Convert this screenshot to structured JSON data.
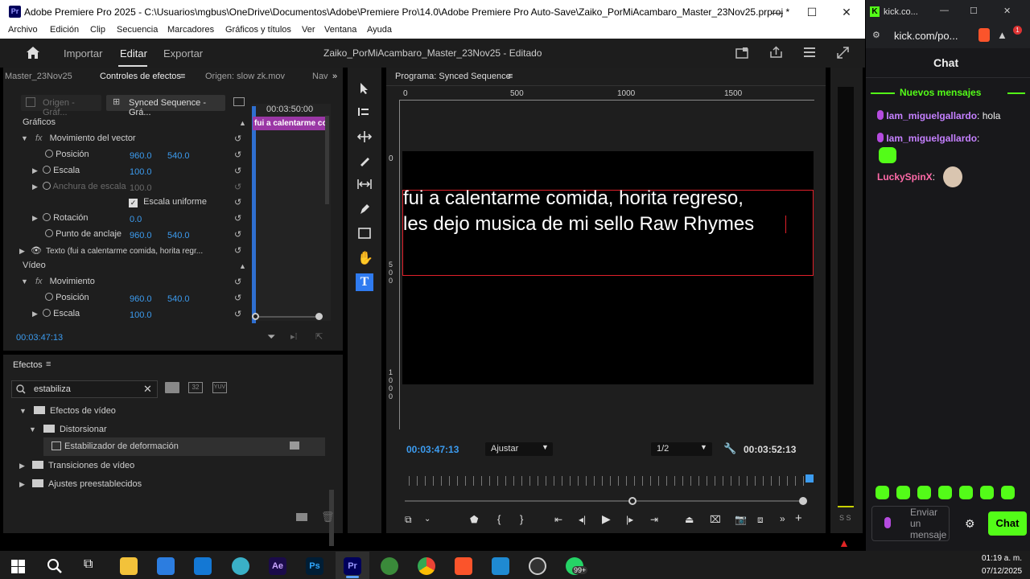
{
  "premiere": {
    "window_title": "Adobe Premiere Pro 2025 - C:\\Usuarios\\mgbus\\OneDrive\\Documentos\\Adobe\\Premiere Pro\\14.0\\Adobe Premiere Pro Auto-Save\\Zaiko_PorMiAcambaro_Master_23Nov25.prproj *",
    "logo": "Pr",
    "menu": [
      "Archivo",
      "Edición",
      "Clip",
      "Secuencia",
      "Marcadores",
      "Gráficos y títulos",
      "Ver",
      "Ventana",
      "Ayuda"
    ],
    "header": {
      "home": "home-icon",
      "import": "Importar",
      "edit": "Editar",
      "export": "Exportar",
      "project": "Zaiko_PorMiAcambaro_Master_23Nov25 - Editado"
    },
    "effect_controls": {
      "tabs": [
        "Master_23Nov25",
        "Controles de efectos",
        "Origen: slow zk.mov",
        "Nav"
      ],
      "source_btn": "Origen - Gráf...",
      "seq_btn": "Synced Sequence - Grá...",
      "timecode_top": "00:03:50:00",
      "clip_label": "fui a calentarme co",
      "section_graphics": "Gráficos",
      "vector_motion": "Movimiento del vector",
      "position_label": "Posición",
      "position_x": "960.0",
      "position_y": "540.0",
      "scale_label": "Escala",
      "scale_value": "100.0",
      "scale_width_label": "Anchura de escala",
      "scale_width_value": "100.0",
      "uniform_scale": "Escala uniforme",
      "rotation_label": "Rotación",
      "rotation_value": "0.0",
      "anchor_label": "Punto de anclaje",
      "anchor_x": "960.0",
      "anchor_y": "540.0",
      "text_layer": "Texto (fui a calentarme comida, horita regr...",
      "section_video": "Vídeo",
      "motion": "Movimiento",
      "position2_label": "Posición",
      "position2_x": "960.0",
      "position2_y": "540.0",
      "scale2_label": "Escala",
      "scale2_value": "100.0",
      "timecode_bottom": "00:03:47:13"
    },
    "effects_panel": {
      "title": "Efectos",
      "search_value": "estabiliza",
      "items": [
        "Efectos de vídeo",
        "Distorsionar",
        "Estabilizador de deformación",
        "Transiciones de vídeo",
        "Ajustes preestablecidos"
      ]
    },
    "program": {
      "title": "Programa: Synced Sequence",
      "ruler_h": [
        "0",
        "500",
        "1000",
        "1500"
      ],
      "ruler_v": [
        "0",
        "5\n0\n0",
        "1\n0\n0\n0"
      ],
      "caption_line1": "fui a calentarme comida, horita regreso,",
      "caption_line2": "les dejo musica de mi sello Raw Rhymes",
      "timecode": "00:03:47:13",
      "fit": "Ajustar",
      "resolution": "1/2",
      "duration": "00:03:52:13",
      "meter_label": "S S"
    }
  },
  "kick": {
    "tab_title": "kick.co...",
    "url": "kick.com/po...",
    "header": "Chat",
    "new_messages": "Nuevos mensajes",
    "messages": [
      {
        "user": "Iam_miguelgallardo",
        "text": "hola",
        "color": "#c580ff"
      },
      {
        "user": "Iam_miguelgallardo",
        "text": "",
        "color": "#c580ff"
      },
      {
        "user": "LuckySpinX",
        "text": "",
        "color": "#ff6aa8"
      }
    ],
    "send_placeholder": "Enviar un mensaje",
    "chat_button": "Chat",
    "accent": "#53fc18"
  },
  "taskbar": {
    "time": "01:19 a. m.",
    "date": "07/12/2025",
    "whatsapp_badge": "99+",
    "apps": [
      "Ae",
      "Ps",
      "Pr"
    ]
  }
}
